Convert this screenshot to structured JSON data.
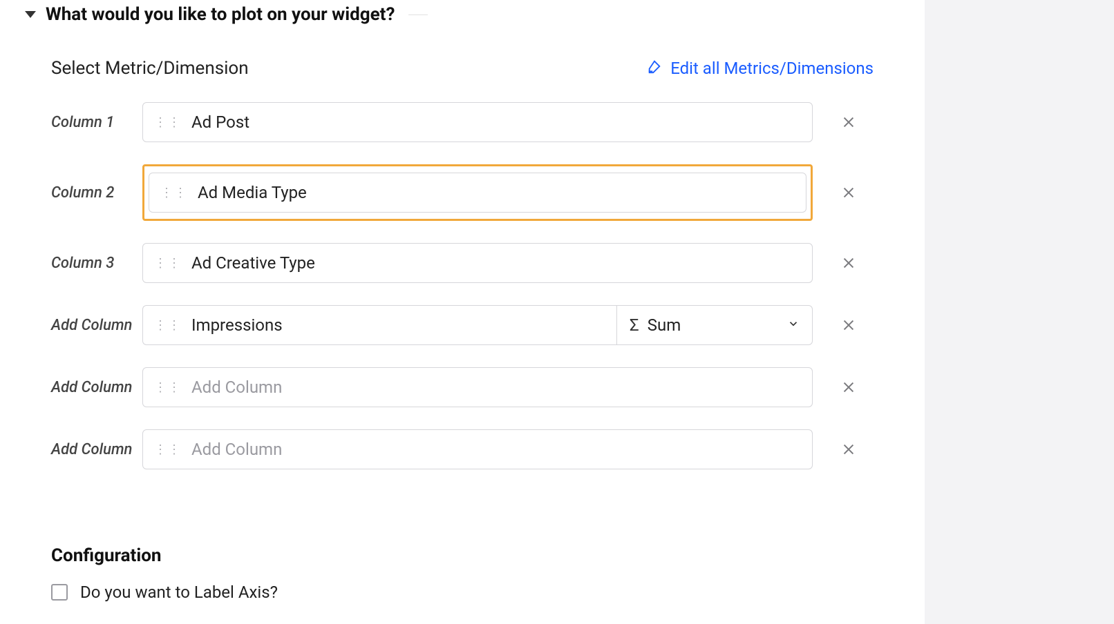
{
  "section": {
    "title": "What would you like to plot on your widget?"
  },
  "header": {
    "select_label": "Select Metric/Dimension",
    "edit_link": "Edit all Metrics/Dimensions"
  },
  "rows": [
    {
      "label": "Column 1",
      "value": "Ad Post",
      "placeholder": "",
      "highlighted": false,
      "agg": null
    },
    {
      "label": "Column 2",
      "value": "Ad Media Type",
      "placeholder": "",
      "highlighted": true,
      "agg": null
    },
    {
      "label": "Column 3",
      "value": "Ad Creative Type",
      "placeholder": "",
      "highlighted": false,
      "agg": null
    },
    {
      "label": "Add Column",
      "value": "Impressions",
      "placeholder": "",
      "highlighted": false,
      "agg": "Sum"
    },
    {
      "label": "Add Column",
      "value": "",
      "placeholder": "Add Column",
      "highlighted": false,
      "agg": null
    },
    {
      "label": "Add Column",
      "value": "",
      "placeholder": "Add Column",
      "highlighted": false,
      "agg": null
    }
  ],
  "config": {
    "title": "Configuration",
    "label_axis": "Do you want to Label Axis?"
  },
  "icons": {
    "sigma": "Σ"
  }
}
